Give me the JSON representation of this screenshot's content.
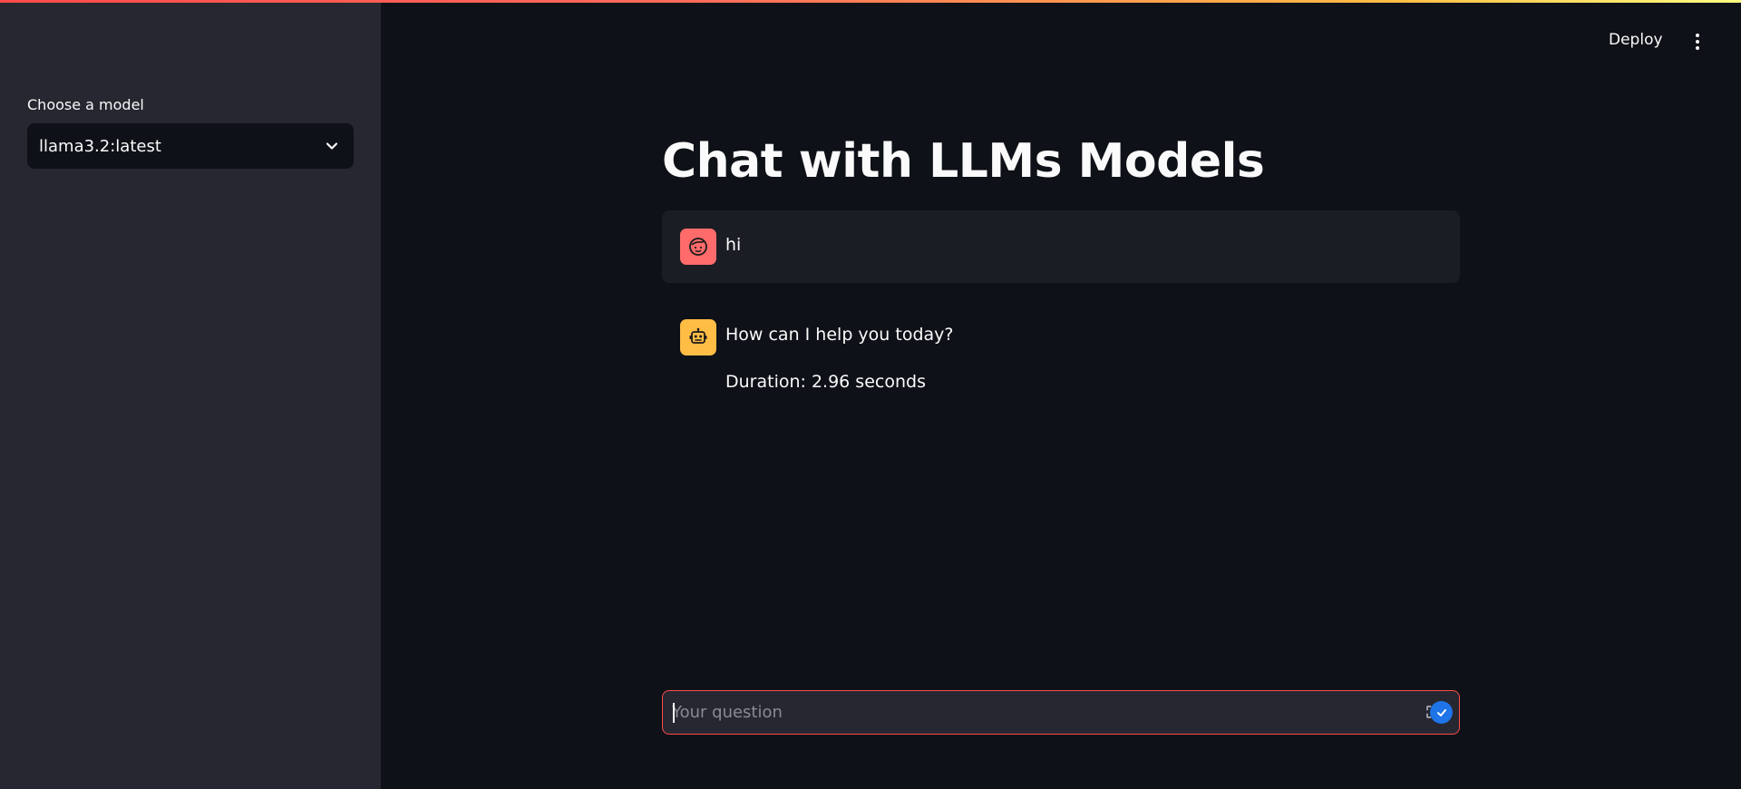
{
  "header": {
    "deploy_label": "Deploy",
    "menu_icon": "more-vertical-icon"
  },
  "sidebar": {
    "model_label": "Choose a model",
    "model_selected": "llama3.2:latest"
  },
  "main": {
    "title": "Chat with LLMs Models",
    "messages": [
      {
        "role": "user",
        "avatar_icon": "user-face-icon",
        "avatar_color": "#ff6b6b",
        "text": "hi"
      },
      {
        "role": "assistant",
        "avatar_icon": "robot-icon",
        "avatar_color": "#ffbd45",
        "text": "How can I help you today?",
        "duration": "Duration: 2.96 seconds"
      }
    ]
  },
  "chat_input": {
    "placeholder": "Your question",
    "value": ""
  },
  "colors": {
    "background": "#0e1117",
    "sidebar": "#262730",
    "accent": "#ff4b4b",
    "send_button": "#1f74e8"
  }
}
